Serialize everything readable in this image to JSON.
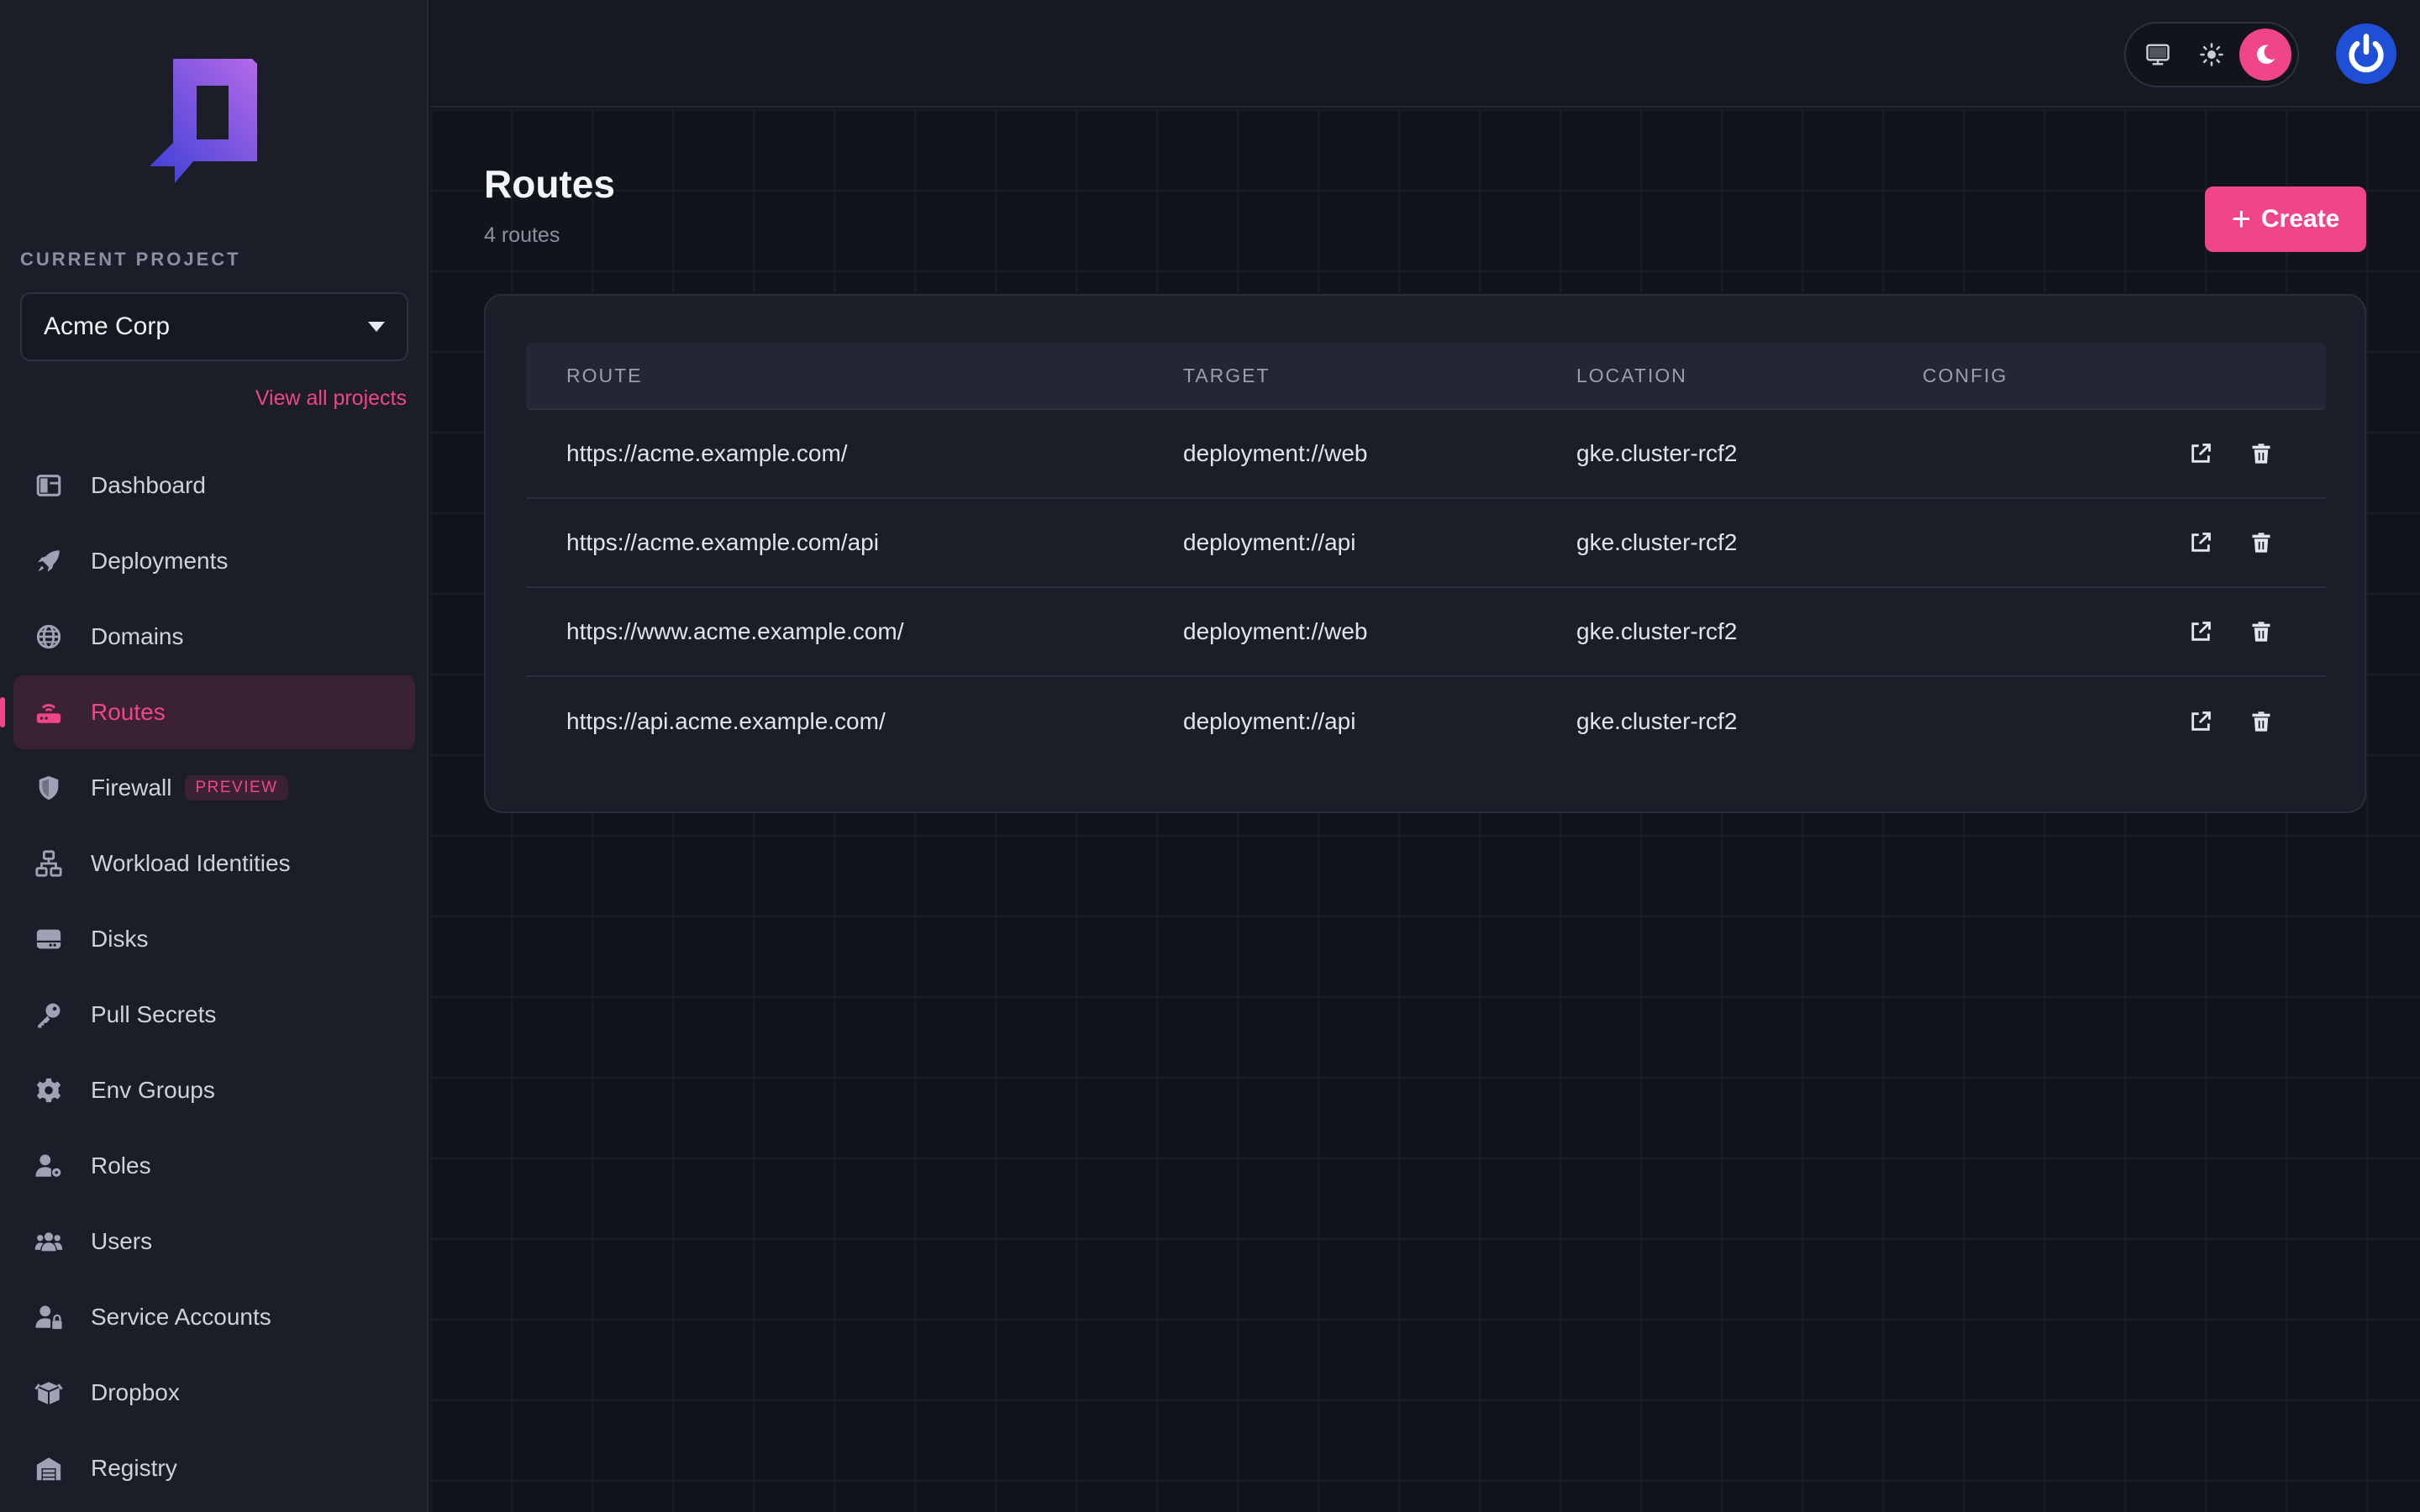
{
  "sidebar": {
    "project_label": "CURRENT PROJECT",
    "project_name": "Acme Corp",
    "view_all": "View all projects",
    "items": [
      {
        "label": "Dashboard",
        "icon": "dashboard-icon"
      },
      {
        "label": "Deployments",
        "icon": "rocket-icon"
      },
      {
        "label": "Domains",
        "icon": "globe-icon"
      },
      {
        "label": "Routes",
        "icon": "router-icon",
        "active": true
      },
      {
        "label": "Firewall",
        "icon": "shield-icon",
        "badge": "PREVIEW"
      },
      {
        "label": "Workload Identities",
        "icon": "network-icon"
      },
      {
        "label": "Disks",
        "icon": "disk-icon"
      },
      {
        "label": "Pull Secrets",
        "icon": "key-icon"
      },
      {
        "label": "Env Groups",
        "icon": "gear-icon"
      },
      {
        "label": "Roles",
        "icon": "user-gear-icon"
      },
      {
        "label": "Users",
        "icon": "users-icon"
      },
      {
        "label": "Service Accounts",
        "icon": "user-lock-icon"
      },
      {
        "label": "Dropbox",
        "icon": "box-icon"
      },
      {
        "label": "Registry",
        "icon": "warehouse-icon"
      }
    ]
  },
  "topbar": {
    "theme_options": [
      "monitor-icon",
      "sun-icon",
      "moon-icon"
    ],
    "active_theme": "moon-icon"
  },
  "main": {
    "title": "Routes",
    "subtitle": "4 routes",
    "create_label": "Create",
    "columns": {
      "route": "ROUTE",
      "target": "TARGET",
      "location": "LOCATION",
      "config": "CONFIG"
    },
    "rows": [
      {
        "route": "https://acme.example.com/",
        "target": "deployment://web",
        "location": "gke.cluster-rcf2",
        "config": ""
      },
      {
        "route": "https://acme.example.com/api",
        "target": "deployment://api",
        "location": "gke.cluster-rcf2",
        "config": ""
      },
      {
        "route": "https://www.acme.example.com/",
        "target": "deployment://web",
        "location": "gke.cluster-rcf2",
        "config": ""
      },
      {
        "route": "https://api.acme.example.com/",
        "target": "deployment://api",
        "location": "gke.cluster-rcf2",
        "config": ""
      }
    ]
  },
  "colors": {
    "accent": "#f0458a",
    "sidebar_bg": "#1b1d28",
    "page_bg": "#12141c",
    "avatar": "#1f4fd6"
  }
}
